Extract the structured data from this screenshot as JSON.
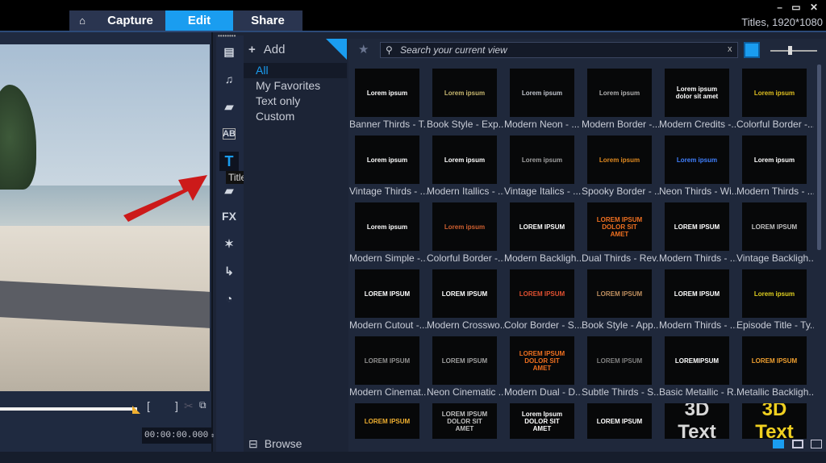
{
  "tabs": [
    {
      "label": "Capture"
    },
    {
      "label": "Edit"
    },
    {
      "label": "Share"
    }
  ],
  "window": {
    "title": "Titles, 1920*1080",
    "controls": "– ▭ ✕"
  },
  "preview": {
    "timecode": "00:00:00.000",
    "mark_in": "[",
    "mark_out": "]"
  },
  "tools": {
    "tooltip": "Titles",
    "fx_label": "FX"
  },
  "categories": {
    "add_label": "Add",
    "items": [
      {
        "label": "All"
      },
      {
        "label": "My Favorites"
      },
      {
        "label": "Text only"
      },
      {
        "label": "Custom"
      }
    ],
    "browse_label": "Browse"
  },
  "search": {
    "placeholder": "Search your current view",
    "clear": "x"
  },
  "thumbs": [
    {
      "label": "Banner Thirds - T...",
      "preview": "Lorem ipsum",
      "color": "#ffffff"
    },
    {
      "label": "Book Style - Exp...",
      "preview": "Lorem ipsum",
      "color": "#c8b870"
    },
    {
      "label": "Modern Neon - ...",
      "preview": "Lorem ipsum",
      "color": "#c0c4cc"
    },
    {
      "label": "Modern Border -...",
      "preview": "Lorem ipsum",
      "color": "#b0b0b0"
    },
    {
      "label": "Modern Credits -...",
      "preview": "Lorem ipsum dolor sit amet",
      "color": "#ffffff"
    },
    {
      "label": "Colorful Border -...",
      "preview": "Lorem ipsum",
      "color": "#e0c020"
    },
    {
      "label": "Vintage Thirds - ...",
      "preview": "Lorem ipsum",
      "color": "#ffffff"
    },
    {
      "label": "Modern Itallics - ...",
      "preview": "Lorem ipsum",
      "color": "#ffffff"
    },
    {
      "label": "Vintage Italics - ...",
      "preview": "Lorem ipsum",
      "color": "#a0a0a0"
    },
    {
      "label": "Spooky Border - ...",
      "preview": "Lorem ipsum",
      "color": "#e08a20"
    },
    {
      "label": "Neon Thirds - Wi...",
      "preview": "Lorem ipsum",
      "color": "#4080ff"
    },
    {
      "label": "Modern Thirds - ...",
      "preview": "Lorem ipsum",
      "color": "#ffffff"
    },
    {
      "label": "Modern Simple -...",
      "preview": "Lorem ipsum",
      "color": "#ffffff"
    },
    {
      "label": "Colorful Border -...",
      "preview": "Lorem ipsum",
      "color": "#d06030"
    },
    {
      "label": "Modern Backligh...",
      "preview": "LOREM IPSUM",
      "color": "#ffffff"
    },
    {
      "label": "Dual Thirds - Rev...",
      "preview": "LOREM IPSUM DOLOR SIT AMET",
      "color": "#f07020"
    },
    {
      "label": "Modern Thirds - ...",
      "preview": "LOREM IPSUM",
      "color": "#ffffff"
    },
    {
      "label": "Vintage Backligh...",
      "preview": "LOREM IPSUM",
      "color": "#c0c0c0"
    },
    {
      "label": "Modern Cutout -...",
      "preview": "LOREM IPSUM",
      "color": "#ffffff"
    },
    {
      "label": "Modern Crosswo...",
      "preview": "LOREM IPSUM",
      "color": "#ffffff"
    },
    {
      "label": "Color Border - S...",
      "preview": "LOREM IPSUM",
      "color": "#e05030"
    },
    {
      "label": "Book Style - App...",
      "preview": "LOREM IPSUM",
      "color": "#c09060"
    },
    {
      "label": "Modern Thirds - ...",
      "preview": "LOREM IPSUM",
      "color": "#ffffff"
    },
    {
      "label": "Episode Title - Ty...",
      "preview": "Lorem ipsum",
      "color": "#e0d020"
    },
    {
      "label": "Modern Cinemat...",
      "preview": "LOREM IPSUM",
      "color": "#909090"
    },
    {
      "label": "Neon Cinematic ...",
      "preview": "LOREM IPSUM",
      "color": "#a0a0a0"
    },
    {
      "label": "Modern Dual - D...",
      "preview": "LOREM IPSUM DOLOR SIT AMET",
      "color": "#f07020"
    },
    {
      "label": "Subtle Thirds - S...",
      "preview": "LOREM IPSUM",
      "color": "#808080"
    },
    {
      "label": "Basic Metallic - R...",
      "preview": "LOREMIPSUM",
      "color": "#ffffff"
    },
    {
      "label": "Metallic Backligh...",
      "preview": "LOREM IPSUM",
      "color": "#f0a030"
    },
    {
      "preview": "LOREM IPSUM",
      "color": "#f0b030"
    },
    {
      "preview": "LOREM IPSUM DOLOR SIT AMET",
      "color": "#c0c0c0"
    },
    {
      "preview": "Lorem Ipsum DOLOR SIT AMET",
      "color": "#ffffff"
    },
    {
      "preview": "LOREM IPSUM",
      "color": "#ffffff"
    },
    {
      "preview": "3D Text",
      "color": "#d8d8d8"
    },
    {
      "preview": "3D Text",
      "color": "#f0d020"
    }
  ],
  "colors": {
    "accent": "#1a9df0",
    "arrow": "#cc1a1a"
  }
}
